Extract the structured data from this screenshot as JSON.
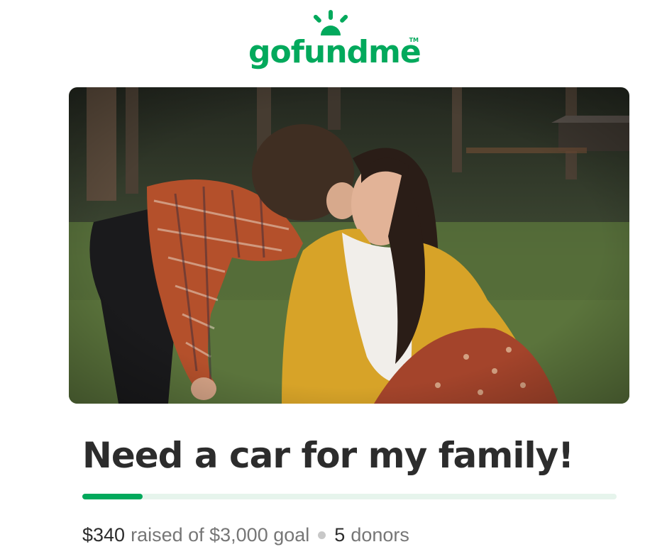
{
  "brand": {
    "name": "gofundme",
    "trademark": "TM",
    "color": "#02a95c",
    "icon": "sun-rays-icon"
  },
  "hero": {
    "image": "photo-child-kissing-woman-on-cheek-in-park"
  },
  "campaign": {
    "title": "Need a car for my family!",
    "raised": "$340",
    "raised_of_text": "raised of $3,000 goal",
    "donors_count": "5",
    "donors_label": "donors",
    "progress_fraction": 0.113
  }
}
